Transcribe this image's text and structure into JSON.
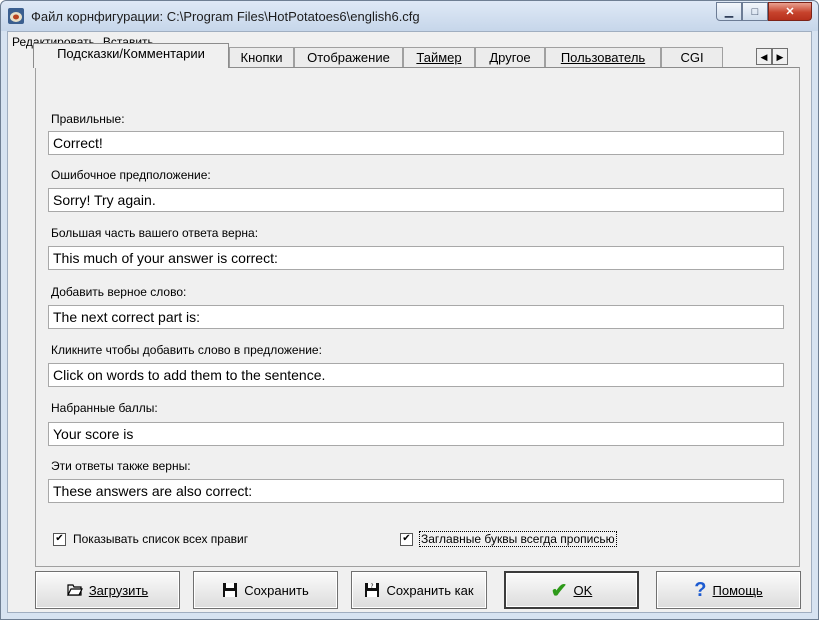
{
  "window": {
    "title": "Файл корнфигурации: C:\\Program Files\\HotPotatoes6\\english6.cfg"
  },
  "menu": {
    "items": [
      "Редактировать",
      "Вставить"
    ]
  },
  "tabs": [
    {
      "label": "Подсказки/Комментарии",
      "active": true
    },
    {
      "label": "Кнопки",
      "active": false
    },
    {
      "label": "Отображение",
      "active": false
    },
    {
      "label": "Таймер",
      "active": false
    },
    {
      "label": "Другое",
      "active": false
    },
    {
      "label": "Пользователь",
      "active": false
    },
    {
      "label": "CGI",
      "active": false
    }
  ],
  "fields": [
    {
      "label": "Правильные:",
      "value": "Correct!"
    },
    {
      "label": "Ошибочное предположение:",
      "value": "Sorry! Try again."
    },
    {
      "label": "Большая часть вашего ответа верна:",
      "value": "This much of your answer is correct:"
    },
    {
      "label": "Добавить верное слово:",
      "value": "The next correct part is:"
    },
    {
      "label": "Кликните чтобы добавить слово в предложение:",
      "value": "Click on words to add them to the sentence."
    },
    {
      "label": "Набранные баллы:",
      "value": "Your score is"
    },
    {
      "label": "Эти ответы также верны:",
      "value": "These answers are also correct:"
    }
  ],
  "checkboxes": [
    {
      "label": "Показывать список всех правиг",
      "checked": true
    },
    {
      "label": "Заглавные буквы всегда прописью",
      "checked": true
    }
  ],
  "buttons": {
    "load": {
      "label": "Загрузить",
      "icon": "folder-open-icon"
    },
    "save": {
      "label": "Сохранить",
      "icon": "floppy-disk-icon"
    },
    "save_as": {
      "label": "Сохранить как",
      "icon": "save-as-icon"
    },
    "ok": {
      "label": "OK",
      "icon": "checkmark-icon"
    },
    "help": {
      "label": "Помощь",
      "icon": "question-icon"
    }
  },
  "colors": {
    "titlebar": "#c6d6ea",
    "close": "#c7432d",
    "ok_check": "#2e9a1a",
    "help_q": "#1c5bd1"
  }
}
